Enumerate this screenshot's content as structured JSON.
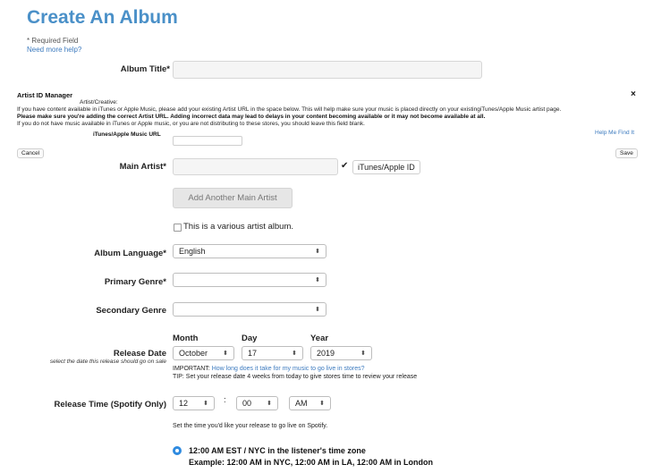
{
  "page": {
    "title": "Create An Album",
    "required_note": "* Required Field",
    "help_link": "Need more help?"
  },
  "album_title": {
    "label": "Album Title*",
    "value": ""
  },
  "artist_id_manager": {
    "heading": "Artist ID Manager",
    "close_glyph": "×",
    "sub_label": "Artist/Creative:",
    "info_line1": "If you have content available in iTunes or Apple Music, please add your existing Artist URL in the space below. This will help make sure your music is placed directly on your existingiTunes/Apple Music artist page.",
    "warning_line": "Please make sure you're adding the correct Artist URL. Adding incorrect data may lead to delays in your content becoming available or it may not become available at all.",
    "info_line2": "If you do not have music available in iTunes or Apple music, or you are not distributing to these stores, you should leave this field blank.",
    "help_find_it": "Help Me Find It",
    "url_label": "iTunes/Apple Music URL",
    "url_value": "",
    "cancel_label": "Cancel",
    "save_label": "Save"
  },
  "main_artist": {
    "label": "Main Artist*",
    "value": "",
    "check_glyph": "✔",
    "tag_label": "iTunes/Apple ID",
    "add_button": "Add Another Main Artist",
    "various_label": "This is a various artist album."
  },
  "album_language": {
    "label": "Album Language*",
    "selected": "English"
  },
  "primary_genre": {
    "label": "Primary Genre*",
    "selected": ""
  },
  "secondary_genre": {
    "label": "Secondary Genre",
    "selected": ""
  },
  "release_date": {
    "label": "Release Date",
    "hint": "select the date this release should go on sale",
    "month_header": "Month",
    "day_header": "Day",
    "year_header": "Year",
    "month": "October",
    "day": "17",
    "year": "2019",
    "important_prefix": "IMPORTANT:",
    "important_link": "How long does it take for my music to go live in stores?",
    "tip": "TIP: Set your release date 4 weeks from today to give stores time to review your release"
  },
  "release_time": {
    "label": "Release Time (Spotify Only)",
    "hour": "12",
    "separator": ":",
    "minute": "00",
    "ampm": "AM",
    "note": "Set the time you'd like your release to go live on Spotify.",
    "option_line1": "12:00 AM EST / NYC in the listener's time zone",
    "option_line2": "Example: 12:00 AM in NYC, 12:00 AM in LA, 12:00 AM in London"
  },
  "colors": {
    "accent": "#4a90c8",
    "link": "#3d7bbf",
    "radio": "#2f8be0"
  }
}
